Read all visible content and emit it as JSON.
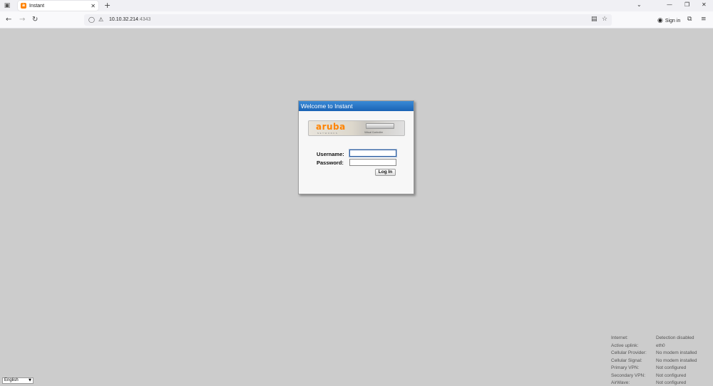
{
  "browser": {
    "tab_title": "Instant",
    "url_host": "10.10.32.214",
    "url_port": ":4343",
    "signin_label": "Sign in"
  },
  "dialog": {
    "title": "Welcome to Instant",
    "logo_text": "aruba",
    "logo_subtext": "NETWORKS",
    "banner_caption": "Virtual Controller",
    "username_label": "Username:",
    "password_label": "Password:",
    "username_value": "",
    "password_value": "",
    "login_label": "Log In"
  },
  "language": {
    "selected": "English"
  },
  "status": {
    "rows": [
      {
        "label": "Internet:",
        "value": "Detection disabled"
      },
      {
        "label": "Active uplink:",
        "value": "eth0"
      },
      {
        "label": "Cellular Provider:",
        "value": "No modem installed"
      },
      {
        "label": "Cellular Signal:",
        "value": "No modem installed"
      },
      {
        "label": "Primary VPN:",
        "value": "Not configured"
      },
      {
        "label": "Secondary VPN:",
        "value": "Not configured"
      },
      {
        "label": "AirWave:",
        "value": "Not configured"
      }
    ]
  },
  "colors": {
    "accent": "#1a63b5",
    "brand": "#ff8300",
    "background": "#cccccc"
  }
}
